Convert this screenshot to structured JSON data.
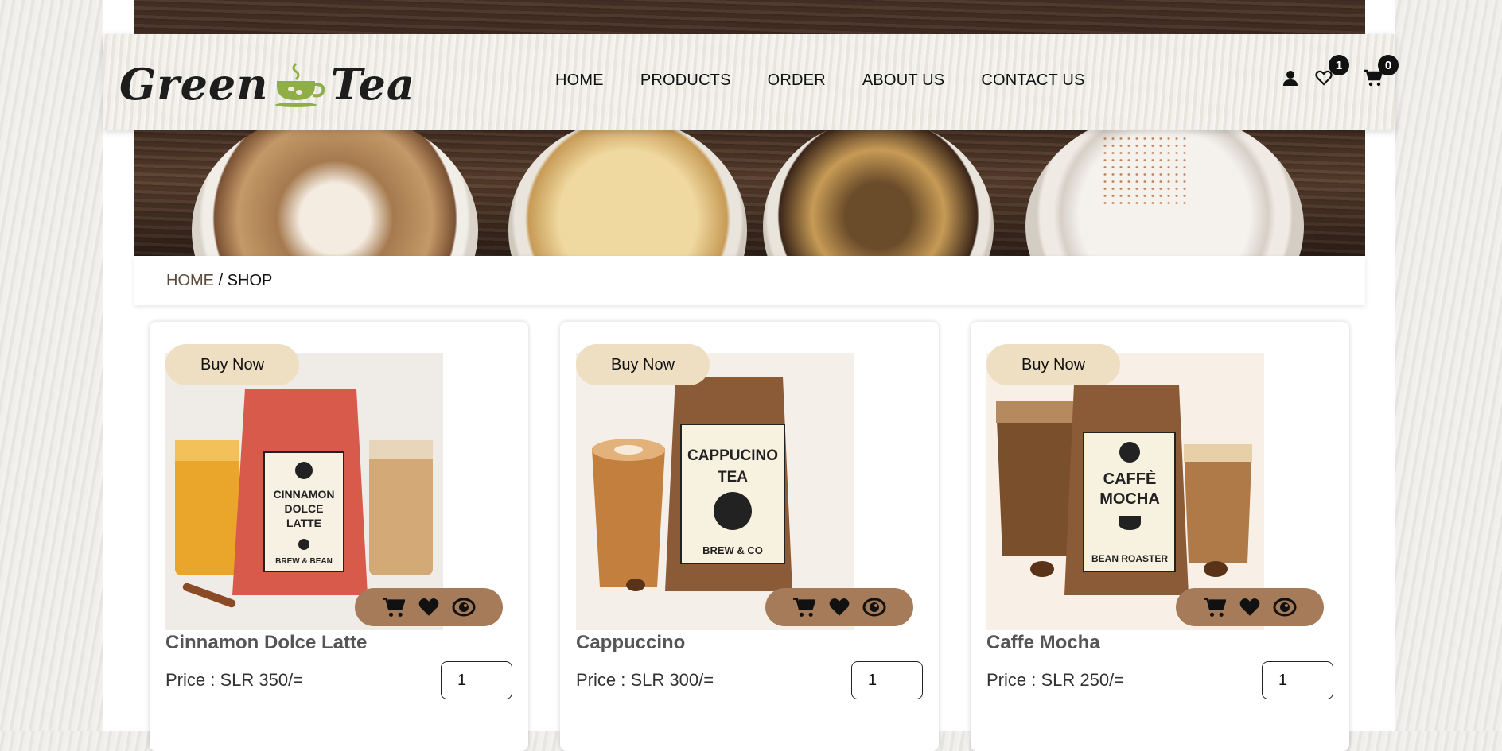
{
  "brand": {
    "word1": "Green",
    "word2": "Tea",
    "accent": "#8fae47"
  },
  "nav": {
    "items": [
      "HOME",
      "PRODUCTS",
      "ORDER",
      "ABOUT US",
      "CONTACT US"
    ],
    "wishlist_count": "1",
    "cart_count": "0"
  },
  "breadcrumb": {
    "home": "HOME",
    "separator": " / ",
    "current": "SHOP"
  },
  "products": [
    {
      "name": "Cinnamon Dolce Latte",
      "price": "Price : SLR 350/=",
      "qty": "1",
      "buy_label": "Buy Now",
      "label_lines": [
        "CINNAMON",
        "DOLCE",
        "LATTE"
      ],
      "label_brand": "BREW & BEAN",
      "bag_color": "#d85a4a"
    },
    {
      "name": "Cappuccino",
      "price": "Price : SLR 300/=",
      "qty": "1",
      "buy_label": "Buy Now",
      "label_lines": [
        "CAPPUCINO",
        "TEA"
      ],
      "label_brand": "BREW & CO",
      "bag_color": "#8b5a36"
    },
    {
      "name": "Caffe Mocha",
      "price": "Price : SLR 250/=",
      "qty": "1",
      "buy_label": "Buy Now",
      "label_lines": [
        "CAFFÈ",
        "MOCHA"
      ],
      "label_brand": "BEAN ROASTER",
      "bag_color": "#8b5a36"
    }
  ],
  "colors": {
    "buy_bg": "#efdfc2",
    "actions_bg": "#a57b59"
  },
  "icons": [
    "user-icon",
    "heart-icon",
    "cart-icon",
    "eye-icon"
  ]
}
